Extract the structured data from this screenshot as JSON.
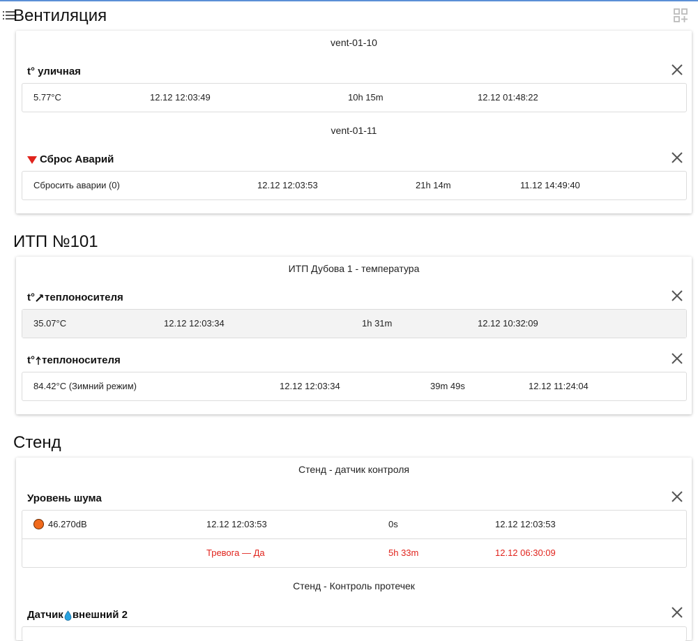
{
  "sections": [
    {
      "title": "Вентиляция",
      "devices": [
        {
          "name": "vent-01-10",
          "params": [
            {
              "title": "t° уличная",
              "rows": [
                {
                  "value": "5.77°C",
                  "time": "12.12 12:03:49",
                  "duration": "10h 15m",
                  "since": "12.12 01:48:22"
                }
              ]
            }
          ]
        },
        {
          "name": "vent-01-11",
          "params": [
            {
              "title": "Сброс Аварий",
              "icon": "red-down-triangle-icon",
              "rows": [
                {
                  "value": "Сбросить аварии (0)",
                  "time": "12.12 12:03:53",
                  "duration": "21h 14m",
                  "since": "11.12 14:49:40"
                }
              ]
            }
          ]
        }
      ]
    },
    {
      "title": "ИТП №101",
      "devices": [
        {
          "name": "ИТП Дубова 1 - температура",
          "params": [
            {
              "title_prefix": "t°",
              "title_suffix": " теплоносителя",
              "icon": "check-arrow-icon",
              "rows": [
                {
                  "value": "35.07°C",
                  "time": "12.12 12:03:34",
                  "duration": "1h 31m",
                  "since": "12.12 10:32:09"
                }
              ]
            },
            {
              "title_prefix": "t°",
              "title_suffix": " теплоносителя",
              "icon": "up-arrow-icon",
              "rows": [
                {
                  "value": "84.42°C (Зимний режим)",
                  "time": "12.12 12:03:34",
                  "duration": "39m 49s",
                  "since": "12.12 11:24:04"
                }
              ]
            }
          ]
        }
      ]
    },
    {
      "title": "Стенд",
      "devices": [
        {
          "name": "Стенд - датчик контроля",
          "params": [
            {
              "title": "Уровень шума",
              "rows": [
                {
                  "value": "46.270dB",
                  "status_color": "#f06a1c",
                  "time": "12.12 12:03:53",
                  "duration": "0s",
                  "since": "12.12 12:03:53"
                },
                {
                  "value": "",
                  "time": "Тревога — Да",
                  "duration": "5h 33m",
                  "since": "12.12 06:30:09",
                  "alarm": true
                }
              ]
            }
          ]
        },
        {
          "name": "Стенд - Контроль протечек",
          "params": [
            {
              "title_prefix": "Датчик",
              "title_suffix": "внешний 2",
              "icon": "water-drop-icon"
            }
          ]
        }
      ]
    }
  ],
  "colors": {
    "alarm": "#e0231c",
    "accent": "#5b8fd6",
    "status_orange": "#f06a1c"
  }
}
